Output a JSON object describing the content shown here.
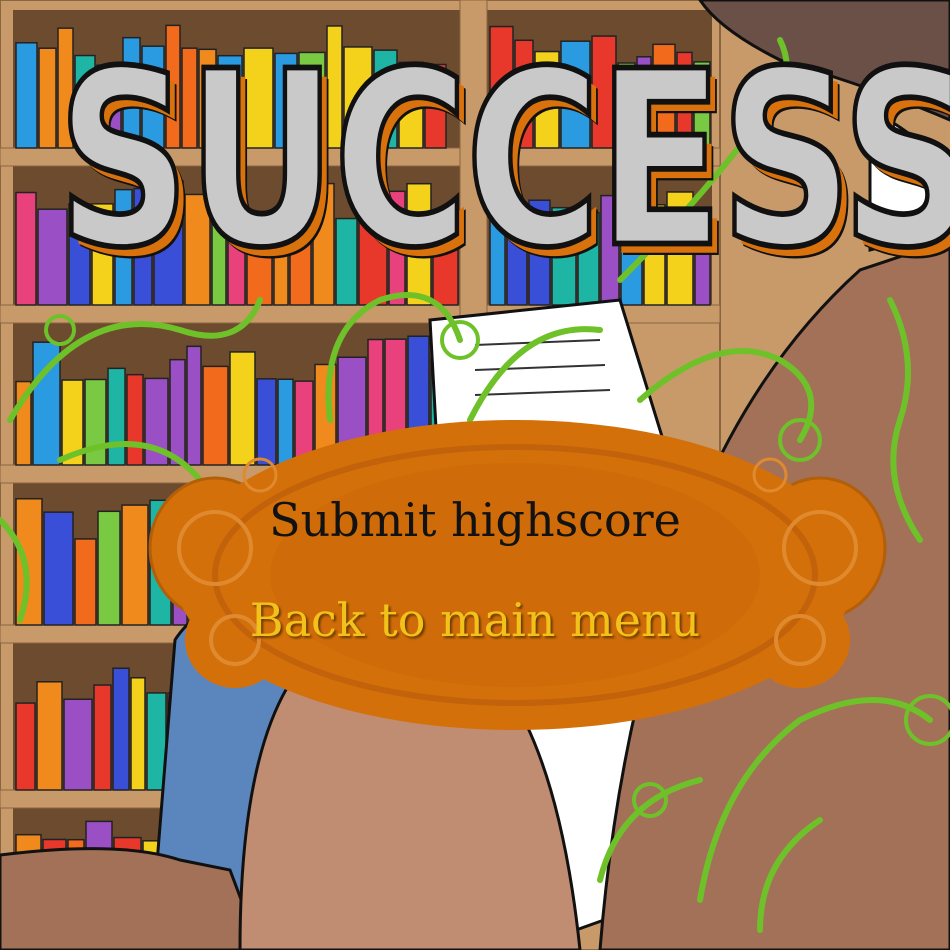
{
  "title": "SUCCESS",
  "menu": {
    "submit_label": "Submit highscore",
    "back_label": "Back to main menu"
  },
  "colors": {
    "title_fill": "#c9c9c9",
    "title_shadow": "#d9720c",
    "panel": "#d4700a",
    "submit_text": "#121212",
    "back_text": "#f2c21a",
    "vines": "#6fc12a"
  }
}
